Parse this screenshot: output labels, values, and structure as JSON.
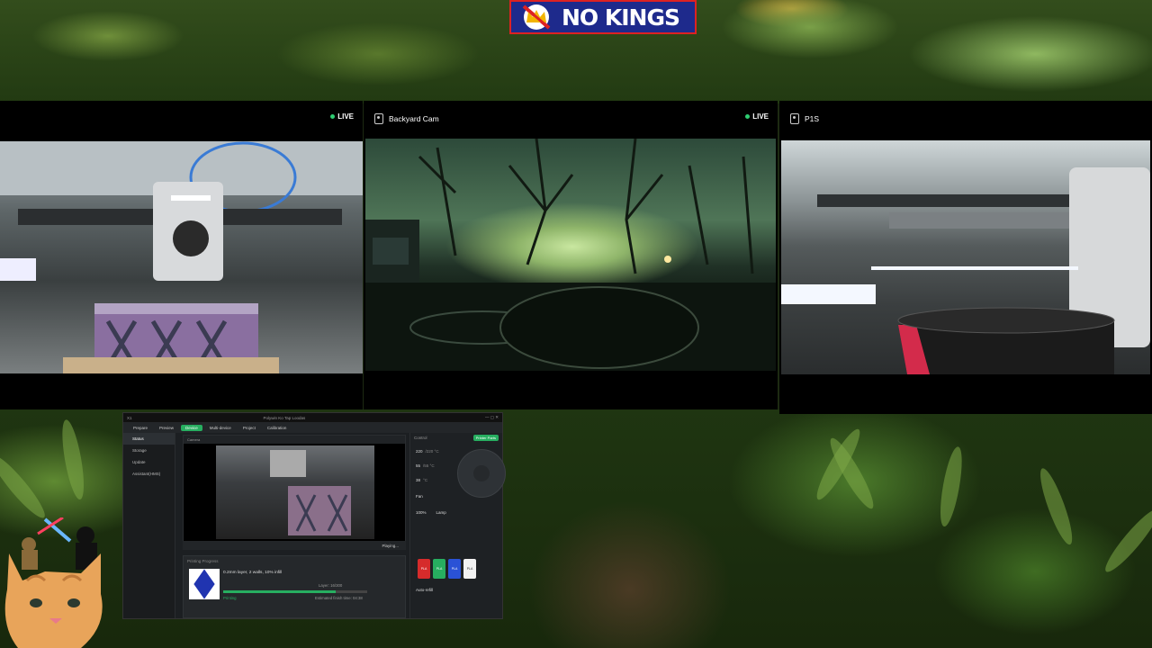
{
  "banner": {
    "text": "NO KINGS",
    "bg_color": "#1e2a8c",
    "border_color": "#dd2222"
  },
  "cameras": [
    {
      "name": "",
      "live_label": "LIVE",
      "icon": "camera-icon"
    },
    {
      "name": "Backyard Cam",
      "live_label": "LIVE",
      "icon": "camera-icon"
    },
    {
      "name": "P1S",
      "live_label": "",
      "icon": "camera-icon"
    }
  ],
  "app": {
    "title": "Polywin Ko Tap Loodas",
    "device_label": "X1",
    "tabs": [
      {
        "label": "Prepare"
      },
      {
        "label": "Preview"
      },
      {
        "label": "Device",
        "active": true
      },
      {
        "label": "Multi-device"
      },
      {
        "label": "Project"
      },
      {
        "label": "Calibration"
      }
    ],
    "sidebar": [
      {
        "label": "Status",
        "active": true
      },
      {
        "label": "Storage"
      },
      {
        "label": "Update"
      },
      {
        "label": "Assistant(HMS)"
      }
    ],
    "camera_bar": "Camera",
    "playing_label": "Playing...",
    "progress": {
      "title": "Printing Progress",
      "description": "0.2mm layer, 2 walls, 10% infill",
      "layer": "Layer: 16/300",
      "state": "Printing",
      "eta": "Estimated finish time: 04:38",
      "fraction": 0.78
    },
    "control": {
      "title": "Control",
      "parts_button": "Printer Parts",
      "temps": [
        {
          "value": "220",
          "target": "/220 °C"
        },
        {
          "value": "55",
          "target": "/55 °C"
        },
        {
          "value": "38",
          "target": "°C"
        }
      ],
      "fan_label": "Fan",
      "lamp_label": "Lamp",
      "speed_label": "100%",
      "auto_refill": "Auto-refill",
      "spools": [
        {
          "label": "PLA",
          "color": "#d62b2b"
        },
        {
          "label": "PLA",
          "color": "#27ae60"
        },
        {
          "label": "PLA",
          "color": "#2a52d6"
        },
        {
          "label": "PLA",
          "color": "#f2f2f2"
        }
      ]
    }
  }
}
